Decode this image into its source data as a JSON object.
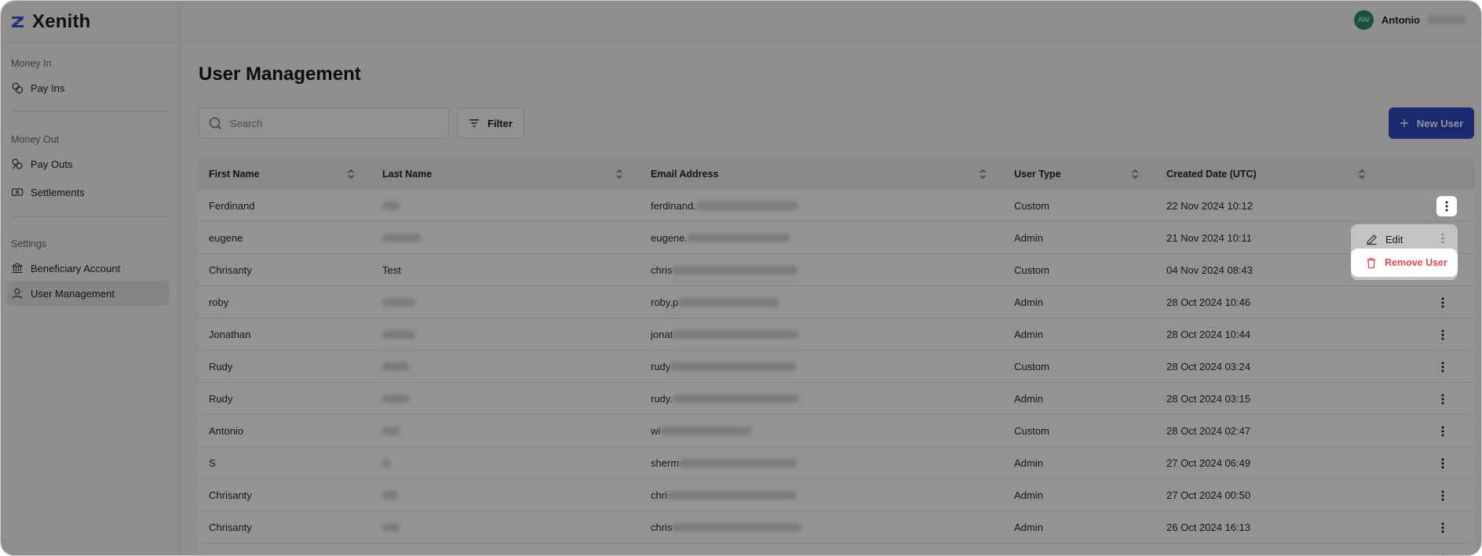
{
  "app": {
    "name": "Xenith"
  },
  "user": {
    "initials": "AW",
    "name": "Antonio"
  },
  "sidebar": {
    "sections": [
      {
        "label": "Money In",
        "items": [
          {
            "label": "Pay Ins",
            "icon": "coins-icon"
          }
        ]
      },
      {
        "label": "Money Out",
        "items": [
          {
            "label": "Pay Outs",
            "icon": "coins-out-icon"
          },
          {
            "label": "Settlements",
            "icon": "banknote-icon"
          }
        ]
      },
      {
        "label": "Settings",
        "items": [
          {
            "label": "Beneficiary Account",
            "icon": "bank-icon"
          },
          {
            "label": "User Management",
            "icon": "user-icon",
            "active": true
          }
        ]
      }
    ]
  },
  "page": {
    "title": "User Management",
    "search_placeholder": "Search",
    "filter_label": "Filter",
    "new_user_label": "New User"
  },
  "table": {
    "columns": [
      "First Name",
      "Last Name",
      "Email Address",
      "User Type",
      "Created Date (UTC)"
    ],
    "rows": [
      {
        "first": "Ferdinand",
        "last": "",
        "email": "ferdinand.",
        "type": "Custom",
        "created": "22 Nov 2024 10:12"
      },
      {
        "first": "eugene",
        "last": "",
        "email": "eugene.",
        "type": "Admin",
        "created": "21 Nov 2024 10:11"
      },
      {
        "first": "Chrisanty",
        "last": "Test",
        "email": "chris",
        "type": "Custom",
        "created": "04 Nov 2024 08:43"
      },
      {
        "first": "roby",
        "last": "",
        "email": "roby.p",
        "type": "Admin",
        "created": "28 Oct 2024 10:46"
      },
      {
        "first": "Jonathan",
        "last": "",
        "email": "jonat",
        "type": "Admin",
        "created": "28 Oct 2024 10:44"
      },
      {
        "first": "Rudy",
        "last": "",
        "email": "rudy",
        "type": "Custom",
        "created": "28 Oct 2024 03:24"
      },
      {
        "first": "Rudy",
        "last": "",
        "email": "rudy.",
        "type": "Admin",
        "created": "28 Oct 2024 03:15"
      },
      {
        "first": "Antonio",
        "last": "",
        "email": "wi",
        "type": "Custom",
        "created": "28 Oct 2024 02:47"
      },
      {
        "first": "S",
        "last": "",
        "email": "sherm",
        "type": "Admin",
        "created": "27 Oct 2024 06:49"
      },
      {
        "first": "Chrisanty",
        "last": "",
        "email": "chri",
        "type": "Admin",
        "created": "27 Oct 2024 00:50"
      },
      {
        "first": "Chrisanty",
        "last": "",
        "email": "chris",
        "type": "Admin",
        "created": "26 Oct 2024 16:13"
      },
      {
        "first": "",
        "last": "",
        "email": "",
        "type": "",
        "created": ""
      }
    ]
  },
  "row_menu": {
    "edit_label": "Edit",
    "remove_label": "Remove User"
  },
  "colors": {
    "primary": "#2f48c2",
    "danger": "#e5484d",
    "avatar": "#2f8e6b"
  }
}
